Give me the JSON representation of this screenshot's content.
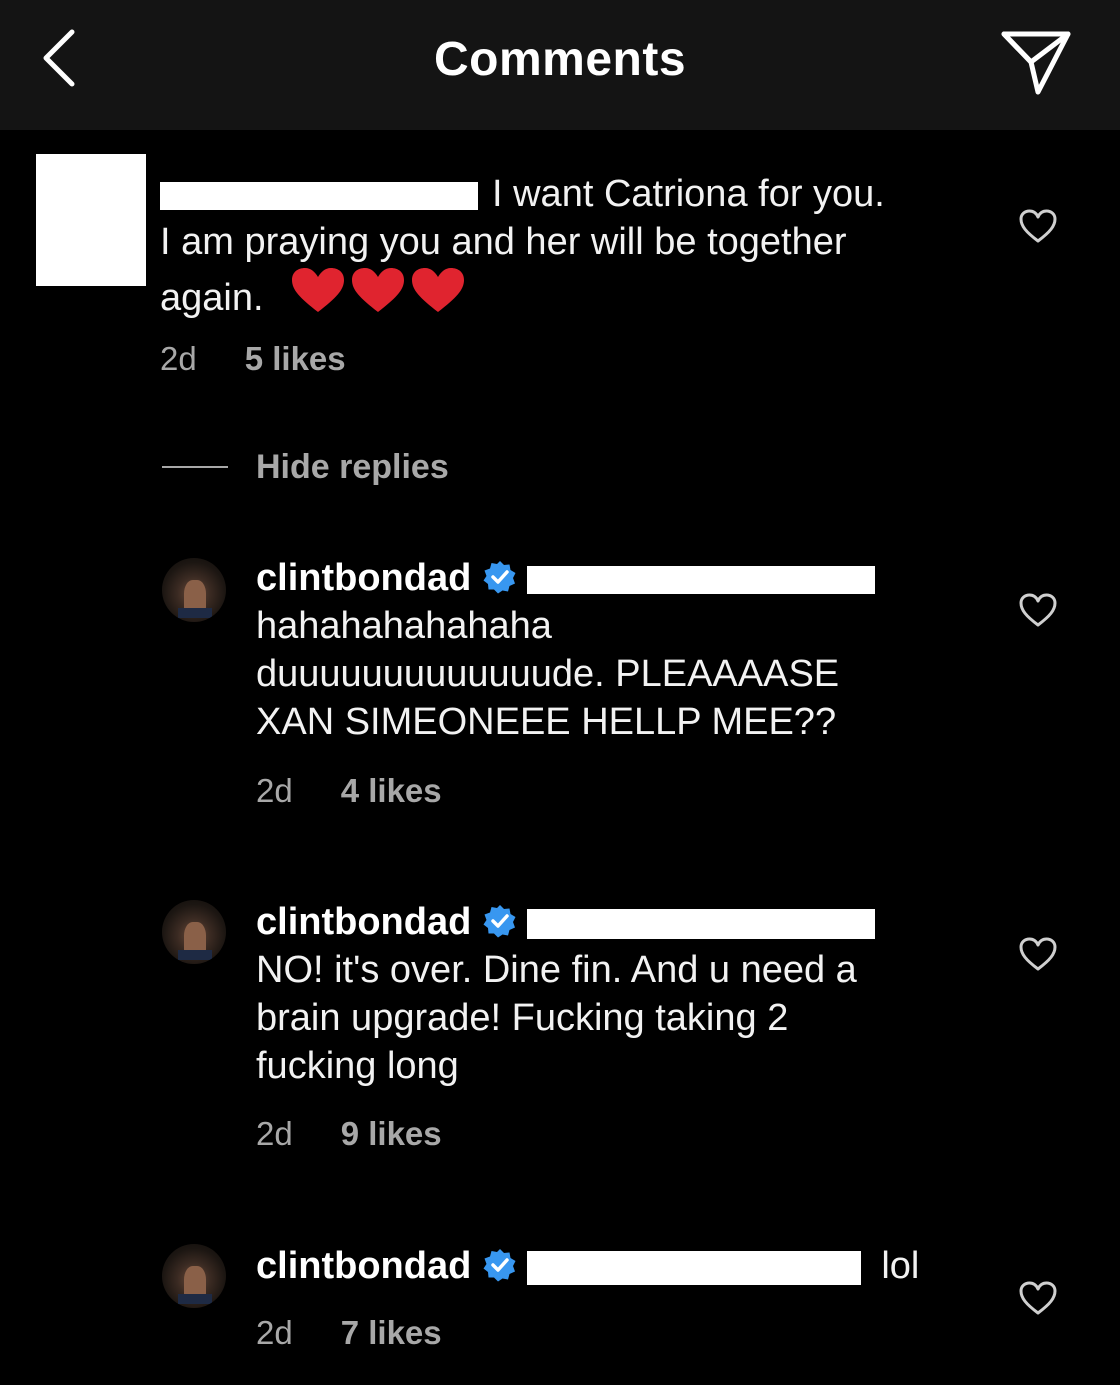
{
  "header": {
    "title": "Comments",
    "back_icon": "chevron-left-icon",
    "share_icon": "paper-plane-icon"
  },
  "colors": {
    "background": "#000000",
    "header_bg": "#141414",
    "meta_text": "#a8a8a8",
    "verified_badge": "#3897f0",
    "heart_emoji": "#e0242f"
  },
  "main_comment": {
    "text_line1": "I want Catriona for you.",
    "text_line2": "I am praying you and her will be together",
    "text_line3": "again.",
    "emoji": "❤️❤️❤️",
    "time": "2d",
    "likes": "5 likes"
  },
  "hide_replies": {
    "label": "Hide replies"
  },
  "replies": [
    {
      "username": "clintbondad",
      "verified": true,
      "lines": [
        "hahahahahahaha",
        "duuuuuuuuuuuuude. PLEAAAASE",
        "XAN SIMEONEEE HELLP MEE??"
      ],
      "time": "2d",
      "likes": "4 likes"
    },
    {
      "username": "clintbondad",
      "verified": true,
      "lines": [
        "NO! it's over. Dine fin. And u need a",
        "brain upgrade! Fucking taking 2",
        "fucking long"
      ],
      "time": "2d",
      "likes": "9 likes"
    },
    {
      "username": "clintbondad",
      "verified": true,
      "text_after": "lol",
      "time": "2d",
      "likes": "7 likes"
    }
  ]
}
